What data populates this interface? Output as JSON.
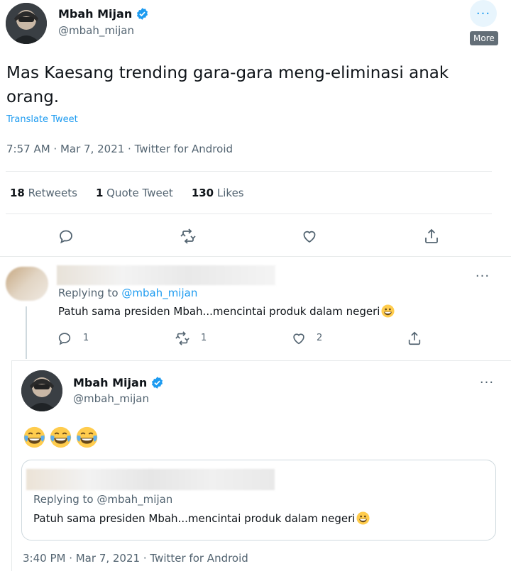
{
  "main_tweet": {
    "author_name": "Mbah Mijan",
    "handle": "@mbah_mijan",
    "text_line1": "Mas Kaesang trending gara-gara meng-eliminasi anak",
    "text_line2": "orang.",
    "translate_label": "Translate Tweet",
    "timestamp": "7:57 AM · Mar 7, 2021 · Twitter for Android",
    "more_tooltip": "More",
    "stats": {
      "retweets_count": "18",
      "retweets_label": "Retweets",
      "quotes_count": "1",
      "quotes_label": "Quote Tweet",
      "likes_count": "130",
      "likes_label": "Likes"
    }
  },
  "reply": {
    "replying_prefix": "Replying to",
    "replying_handle": "@mbah_mijan",
    "text": "Patuh sama presiden Mbah...mencintai produk dalam negeri",
    "reply_count": "1",
    "retweet_count": "1",
    "like_count": "2"
  },
  "quote_tweet": {
    "author_name": "Mbah Mijan",
    "handle": "@mbah_mijan",
    "emoji_text": "😂😂😂",
    "quoted": {
      "replying_line": "Replying to @mbah_mijan",
      "text": "Patuh sama presiden Mbah...mencintai produk dalam negeri"
    },
    "timestamp": "3:40 PM · Mar 7, 2021 · Twitter for Android"
  },
  "icons": {
    "verified": "verified-badge-icon",
    "reply": "reply-icon",
    "retweet": "retweet-icon",
    "like": "like-icon",
    "share": "share-icon",
    "more": "more-icon",
    "smile": "grinning-face-emoji",
    "cry": "face-with-tears-of-joy-emoji"
  },
  "colors": {
    "accent": "#1d9bf0",
    "text": "#0f1419",
    "secondary": "#536471"
  }
}
